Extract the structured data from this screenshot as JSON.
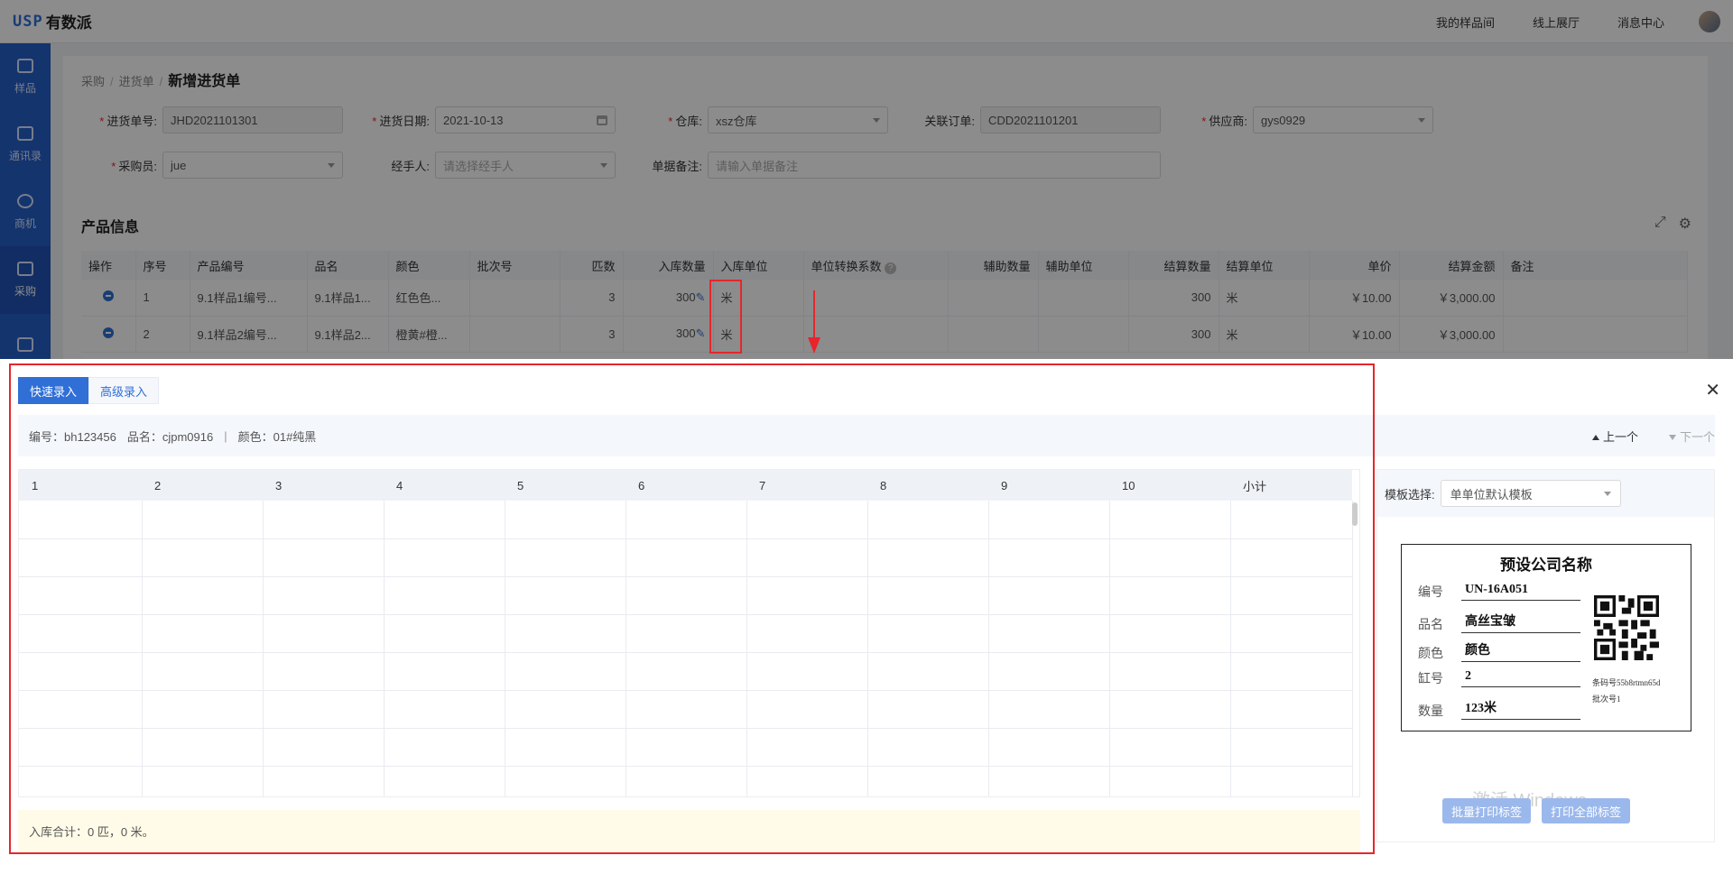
{
  "topbar": {
    "logo_mark": "USP",
    "logo_name": "有数派",
    "nav": [
      "我的样品间",
      "线上展厅",
      "消息中心"
    ]
  },
  "sidebar": {
    "items": [
      {
        "label": "样品",
        "icon": "sample-box-icon"
      },
      {
        "label": "通讯录",
        "icon": "contacts-icon"
      },
      {
        "label": "商机",
        "icon": "opportunity-icon"
      },
      {
        "label": "采购",
        "icon": "purchase-icon"
      }
    ]
  },
  "breadcrumb": {
    "l1": "采购",
    "l2": "进货单",
    "current": "新增进货单"
  },
  "form": {
    "order_no_label": "进货单号",
    "order_no_value": "JHD2021101301",
    "date_label": "进货日期",
    "date_value": "2021-10-13",
    "warehouse_label": "仓库",
    "warehouse_value": "xsz仓库",
    "related_label": "关联订单",
    "related_value": "CDD2021101201",
    "supplier_label": "供应商",
    "supplier_value": "gys0929",
    "buyer_label": "采购员",
    "buyer_value": "jue",
    "handler_label": "经手人",
    "handler_placeholder": "请选择经手人",
    "remark_label": "单据备注",
    "remark_placeholder": "请输入单据备注"
  },
  "product_section": {
    "title": "产品信息",
    "headers": [
      "操作",
      "序号",
      "产品编号",
      "品名",
      "颜色",
      "批次号",
      "匹数",
      "入库数量",
      "入库单位",
      "单位转换系数",
      "辅助数量",
      "辅助单位",
      "结算数量",
      "结算单位",
      "单价",
      "结算金额",
      "备注"
    ],
    "rows": [
      {
        "seq": "1",
        "code": "9.1样品1编号...",
        "name": "9.1样品1...",
        "color": "红色色...",
        "batch": "",
        "pieces": "3",
        "qty": "300",
        "unit": "米",
        "factor": "",
        "aux_qty": "",
        "aux_unit": "",
        "settle_qty": "300",
        "settle_unit": "米",
        "price": "￥10.00",
        "amount": "￥3,000.00",
        "remark": ""
      },
      {
        "seq": "2",
        "code": "9.1样品2编号...",
        "name": "9.1样品2...",
        "color": "橙黄#橙...",
        "batch": "",
        "pieces": "3",
        "qty": "300",
        "unit": "米",
        "factor": "",
        "aux_qty": "",
        "aux_unit": "",
        "settle_qty": "300",
        "settle_unit": "米",
        "price": "￥10.00",
        "amount": "￥3,000.00",
        "remark": ""
      }
    ]
  },
  "drawer": {
    "tabs": [
      "快速录入",
      "高级录入"
    ],
    "info": {
      "code": "编号：bh123456",
      "name": "品名：cjpm0916",
      "divider": "|",
      "color": "颜色：01#纯黑"
    },
    "prev_label": "上一个",
    "next_label": "下一个",
    "grid_headers": [
      "1",
      "2",
      "3",
      "4",
      "5",
      "6",
      "7",
      "8",
      "9",
      "10",
      "小计"
    ],
    "summary": "入库合计：0 匹，0 米。",
    "template_label": "模板选择:",
    "template_value": "单单位默认模板",
    "label_card": {
      "title": "预设公司名称",
      "rows": [
        {
          "k": "编号",
          "v": "UN-16A051"
        },
        {
          "k": "品名",
          "v": "高丝宝皱"
        },
        {
          "k": "颜色",
          "v": "颜色"
        },
        {
          "k": "缸号",
          "v": "2"
        },
        {
          "k": "数量",
          "v": "123米"
        }
      ],
      "barcode_text": "条码号55b8rtmn65d",
      "batch_text": "批次号1"
    },
    "btn_batch_print": "批量打印标签",
    "btn_print_all": "打印全部标签",
    "watermark": "激活 Windows"
  }
}
